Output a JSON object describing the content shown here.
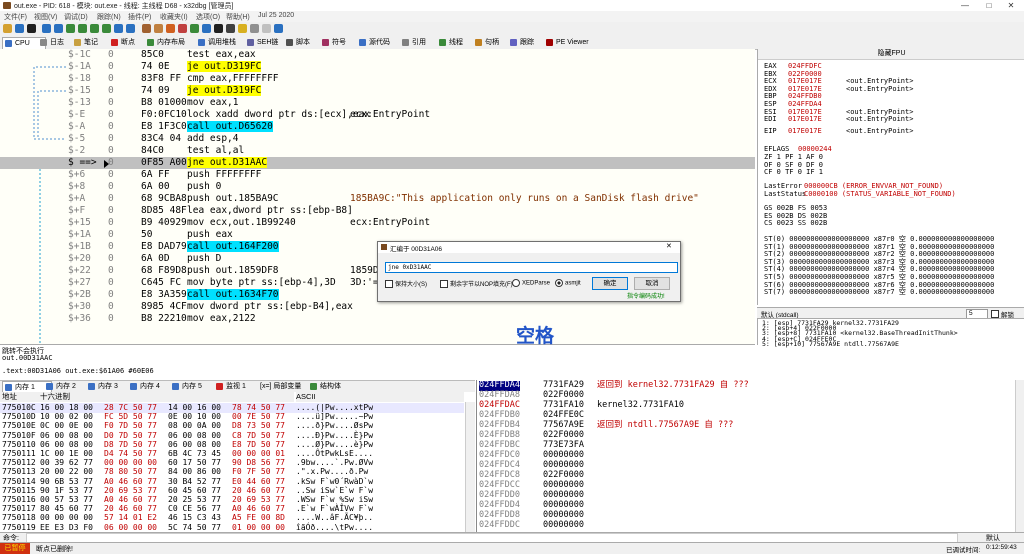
{
  "window": {
    "title": "out.exe - PID: 618 - 模块: out.exe - 线程: 主线程 D68 - x32dbg [管理员]",
    "minimize": "—",
    "maximize": "□",
    "close": "✕"
  },
  "menu": [
    "文件(F)",
    "视图(V)",
    "调试(D)",
    "跟踪(N)",
    "插件(P)",
    "收藏夹(I)",
    "选项(O)",
    "帮助(H)",
    "Jul 25 2020"
  ],
  "tabs": [
    {
      "label": "CPU",
      "color": "#3a6fc4"
    },
    {
      "label": "日志",
      "color": "#888888"
    },
    {
      "label": "笔记",
      "color": "#c8a040"
    },
    {
      "label": "断点",
      "color": "#d02020"
    },
    {
      "label": "内存布局",
      "color": "#3a8a3a"
    },
    {
      "label": "调用堆栈",
      "color": "#3a6fc4"
    },
    {
      "label": "SEH链",
      "color": "#6060a0"
    },
    {
      "label": "脚本",
      "color": "#505050"
    },
    {
      "label": "符号",
      "color": "#a03060"
    },
    {
      "label": "源代码",
      "color": "#3a6fc4"
    },
    {
      "label": "引用",
      "color": "#808080"
    },
    {
      "label": "线程",
      "color": "#3a8a3a"
    },
    {
      "label": "句柄",
      "color": "#c08020"
    },
    {
      "label": "跟踪",
      "color": "#6060c0"
    },
    {
      "label": "PE Viewer",
      "color": "#a00000"
    }
  ],
  "disasm": [
    {
      "label": "$-1C",
      "addr": "0",
      "bytes": "85C0",
      "ins": [
        {
          "t": "test eax,eax"
        }
      ],
      "cmt": ""
    },
    {
      "label": "$-1A",
      "addr": "0",
      "bytes": "74 0E",
      "ins": [
        {
          "t": "je out.D319FC",
          "c": "y"
        }
      ],
      "cmt": ""
    },
    {
      "label": "$-18",
      "addr": "0",
      "bytes": "83F8 FF",
      "ins": [
        {
          "t": "cmp eax,FFFFFFFF"
        }
      ],
      "cmt": ""
    },
    {
      "label": "$-15",
      "addr": "0",
      "bytes": "74 09",
      "ins": [
        {
          "t": "je out.D319FC",
          "c": "y"
        }
      ],
      "cmt": ""
    },
    {
      "label": "$-13",
      "addr": "0",
      "bytes": "B8 01000000",
      "ins": [
        {
          "t": "mov eax,1"
        }
      ],
      "cmt": ""
    },
    {
      "label": "$-E",
      "addr": "0",
      "bytes": "F0:0FC10",
      "ins": [
        {
          "t": "lock xadd dword ptr ds:[ecx],eax"
        }
      ],
      "cmt": "ecx:EntryPoint"
    },
    {
      "label": "$-A",
      "addr": "0",
      "bytes": "E8 1F3C0",
      "ins": [
        {
          "t": "call out.D65620",
          "c": "c"
        }
      ],
      "cmt": ""
    },
    {
      "label": "$-5",
      "addr": "0",
      "bytes": "83C4 04",
      "ins": [
        {
          "t": "add esp,4"
        }
      ],
      "cmt": ""
    },
    {
      "label": "$-2",
      "addr": "0",
      "bytes": "84C0",
      "ins": [
        {
          "t": "test al,al"
        }
      ],
      "cmt": ""
    },
    {
      "label": "$ ==>",
      "addr": "0",
      "bytes": "0F85 A000",
      "ins": [
        {
          "t": "jne out.D31AAC",
          "c": "y"
        }
      ],
      "cmt": "",
      "current": true
    },
    {
      "label": "$+6",
      "addr": "0",
      "bytes": "6A FF",
      "ins": [
        {
          "t": "push FFFFFFFF"
        }
      ],
      "cmt": ""
    },
    {
      "label": "$+8",
      "addr": "0",
      "bytes": "6A 00",
      "ins": [
        {
          "t": "push 0"
        }
      ],
      "cmt": ""
    },
    {
      "label": "$+A",
      "addr": "0",
      "bytes": "68 9CBA85",
      "ins": [
        {
          "t": "push out.185BA9C"
        }
      ],
      "cmt": "185BA9C:\"This application only runs on a SanDisk flash drive\""
    },
    {
      "label": "$+F",
      "addr": "0",
      "bytes": "8D85 48FF",
      "ins": [
        {
          "t": "lea eax,dword ptr ss:[ebp-B8]"
        }
      ],
      "cmt": ""
    },
    {
      "label": "$+15",
      "addr": "0",
      "bytes": "B9 40929B",
      "ins": [
        {
          "t": "mov ecx,out.1B99240"
        }
      ],
      "cmt": "ecx:EntryPoint"
    },
    {
      "label": "$+1A",
      "addr": "0",
      "bytes": "50",
      "ins": [
        {
          "t": "push eax"
        }
      ],
      "cmt": ""
    },
    {
      "label": "$+1B",
      "addr": "0",
      "bytes": "E8 DAD79",
      "ins": [
        {
          "t": "call out.164F200",
          "c": "c"
        }
      ],
      "cmt": ""
    },
    {
      "label": "$+20",
      "addr": "0",
      "bytes": "6A 0D",
      "ins": [
        {
          "t": "push D"
        }
      ],
      "cmt": ""
    },
    {
      "label": "$+22",
      "addr": "0",
      "bytes": "68 F89D8",
      "ins": [
        {
          "t": "push out.1859DF8"
        }
      ],
      "cmt": "1859D"
    },
    {
      "label": "$+27",
      "addr": "0",
      "bytes": "C645 FC",
      "ins": [
        {
          "t": "mov byte ptr ss:[ebp-4],3D"
        }
      ],
      "cmt": "3D:'="
    },
    {
      "label": "$+2B",
      "addr": "0",
      "bytes": "E8 3A359",
      "ins": [
        {
          "t": "call out.1634F70",
          "c": "c"
        }
      ],
      "cmt": ""
    },
    {
      "label": "$+30",
      "addr": "0",
      "bytes": "8985 4CFF",
      "ins": [
        {
          "t": "mov dword ptr ss:[ebp-B4],eax"
        }
      ],
      "cmt": ""
    },
    {
      "label": "$+36",
      "addr": "0",
      "bytes": "B8 22210",
      "ins": [
        {
          "t": "mov eax,2122"
        }
      ],
      "cmt": ""
    }
  ],
  "registers": {
    "header": "隐藏FPU",
    "gp": [
      {
        "n": "EAX",
        "v": "024FFDFC",
        "c": ""
      },
      {
        "n": "EBX",
        "v": "022F0000",
        "c": ""
      },
      {
        "n": "ECX",
        "v": "017E017E",
        "c": "<out.EntryPoint>"
      },
      {
        "n": "EDX",
        "v": "017E017E",
        "c": "<out.EntryPoint>"
      },
      {
        "n": "EBP",
        "v": "024FFDB0",
        "c": ""
      },
      {
        "n": "ESP",
        "v": "024FFDA4",
        "c": ""
      },
      {
        "n": "ESI",
        "v": "017E017E",
        "c": "<out.EntryPoint>"
      },
      {
        "n": "EDI",
        "v": "017E017E",
        "c": "<out.EntryPoint>"
      }
    ],
    "eip": {
      "n": "EIP",
      "v": "017E017E",
      "c": "<out.EntryPoint>"
    },
    "eflags": {
      "n": "EFLAGS",
      "v": "00000244"
    },
    "flags": [
      "ZF 1  PF 1  AF 0",
      "OF 0  SF 0  DF 0",
      "CF 0  TF 0  IF 1"
    ],
    "lasterror": {
      "n": "LastError",
      "v": "000000CB (ERROR_ENVVAR_NOT_FOUND)"
    },
    "laststatus": {
      "n": "LastStatus",
      "v": "C0000100 (STATUS_VARIABLE_NOT_FOUND)"
    },
    "seg": [
      "GS 002B  FS 0053",
      "ES 002B  DS 002B",
      "CS 0023  SS 002B"
    ],
    "st": [
      "ST(0) 0000000000000000000 x87r0 空 0.000000000000000000",
      "ST(1) 0000000000000000000 x87r1 空 0.000000000000000000",
      "ST(2) 0000000000000000000 x87r2 空 0.000000000000000000",
      "ST(3) 0000000000000000000 x87r3 空 0.000000000000000000",
      "ST(4) 0000000000000000000 x87r4 空 0.000000000000000000",
      "ST(5) 0000000000000000000 x87r5 空 0.000000000000000000",
      "ST(6) 0000000000000000000 x87r6 空 0.000000000000000000",
      "ST(7) 0000000000000000000 x87r7 空 0.000000000000000000"
    ]
  },
  "callconv": {
    "label": "默认 (stdcall)",
    "count": "5",
    "unlock": "解锁"
  },
  "callstack": [
    "1: [esp] 7731FA29 kernel32.7731FA29",
    "2: [esp+4] 022F0000",
    "3: [esp+8] 7731FA10 <kernel32.BaseThreadInitThunk>",
    "4: [esp+C] 024FFE0C",
    "5: [esp+10] 77567A9E ntdll.77567A9E"
  ],
  "info": {
    "line1": "跳转不会执行",
    "line2": "out.00D31AAC",
    "line3": ".text:00D31A06 out.exe:$61A06 #60E06"
  },
  "bottom_tabs": [
    "内存 1",
    "内存 2",
    "内存 3",
    "内存 4",
    "内存 5",
    "监视 1",
    "[x=] 局部变量",
    "结构体"
  ],
  "dump": {
    "headers": {
      "addr": "地址",
      "hex": "十六进制",
      "ascii": "ASCII"
    },
    "rows": [
      {
        "a": "775010C",
        "h1": "16 00 18 00",
        "h2": "28 7C 50 77",
        "h3": "14 00 16 00",
        "h4": "78 74 50 77",
        "asc": "....(|Pw....xtPw"
      },
      {
        "a": "775010D",
        "h1": "10 00 02 00",
        "h2": "FC 5D 50 77",
        "h3": "0E 00 10 00",
        "h4": "00 7E 50 77",
        "asc": "....ü]Pw.....~Pw"
      },
      {
        "a": "775010E",
        "h1": "0C 00 0E 00",
        "h2": "F0 7D 50 77",
        "h3": "08 00 0A 00",
        "h4": "D8 73 50 77",
        "asc": "....ð}Pw....ØsPw"
      },
      {
        "a": "775010F",
        "h1": "06 00 08 00",
        "h2": "D0 7D 50 77",
        "h3": "06 00 08 00",
        "h4": "C8 7D 50 77",
        "asc": "....Ð}Pw....È}Pw"
      },
      {
        "a": "7750110",
        "h1": "06 00 08 00",
        "h2": "D8 7D 50 77",
        "h3": "06 00 08 00",
        "h4": "E8 7D 50 77",
        "asc": "....Ø}Pw....è}Pw"
      },
      {
        "a": "7750111",
        "h1": "1C 00 1E 00",
        "h2": "D4 74 50 77",
        "h3": "6B 4C 73 45",
        "h4": "00 00 00 01",
        "asc": "....ÔtPwkLsE...."
      },
      {
        "a": "7750112",
        "h1": "00 39 62 77",
        "h2": "00 00 00 00",
        "h3": "60 17 50 77",
        "h4": "90 D8 56 77",
        "asc": ".9bw....`.Pw.ØVw"
      },
      {
        "a": "7750113",
        "h1": "20 00 22 00",
        "h2": "78 80 50 77",
        "h3": "84 00 86 00",
        "h4": "F0 7F 50 77",
        "asc": " .\".x.Pw....ð.Pw"
      },
      {
        "a": "7750114",
        "h1": "90 6B 53 77",
        "h2": "A0 46 60 77",
        "h3": "30 B4 52 77",
        "h4": "E0 44 60 77",
        "asc": ".kSw F`w0´RwàD`w"
      },
      {
        "a": "7750115",
        "h1": "90 1F 53 77",
        "h2": "20 69 53 77",
        "h3": "60 45 60 77",
        "h4": "20 46 60 77",
        "asc": "..Sw iSw`E`w F`w"
      },
      {
        "a": "7750116",
        "h1": "00 57 53 77",
        "h2": "A0 46 60 77",
        "h3": "20 25 53 77",
        "h4": "20 69 53 77",
        "asc": ".WSw F`w %Sw iSw"
      },
      {
        "a": "7750117",
        "h1": "80 45 60 77",
        "h2": "20 46 60 77",
        "h3": "C0 CE 56 77",
        "h4": "A0 46 60 77",
        "asc": ".E`w F`wÀÎVw F`w"
      },
      {
        "a": "7750118",
        "h1": "00 00 00 00",
        "h2": "57 14 01 E2",
        "h3": "46 15 C3 43",
        "h4": "A5 FE 00 8D",
        "asc": "....W..âF.ÃC¥þ.."
      },
      {
        "a": "7750119",
        "h1": "EE E3 D3 F0",
        "h2": "06 00 00 00",
        "h3": "5C 74 50 77",
        "h4": "01 00 00 00",
        "asc": "îãÓð....\\tPw...."
      }
    ]
  },
  "stack": {
    "rows": [
      {
        "a": "024FFDA4",
        "v": "7731FA29",
        "c": "返回到 kernel32.7731FA29 自 ???",
        "sel": true
      },
      {
        "a": "024FFDA8",
        "v": "022F0000",
        "c": ""
      },
      {
        "a": "024FFDAC",
        "v": "7731FA10",
        "c": "kernel32.7731FA10",
        "red_addr": true
      },
      {
        "a": "024FFDB0",
        "v": "024FFE0C",
        "c": ""
      },
      {
        "a": "024FFDB4",
        "v": "77567A9E",
        "c": "返回到 ntdll.77567A9E 自 ???"
      },
      {
        "a": "024FFDB8",
        "v": "022F0000",
        "c": ""
      },
      {
        "a": "024FFDBC",
        "v": "773E73FA",
        "c": ""
      },
      {
        "a": "024FFDC0",
        "v": "00000000",
        "c": ""
      },
      {
        "a": "024FFDC4",
        "v": "00000000",
        "c": ""
      },
      {
        "a": "024FFDC8",
        "v": "022F0000",
        "c": ""
      },
      {
        "a": "024FFDCC",
        "v": "00000000",
        "c": ""
      },
      {
        "a": "024FFDD0",
        "v": "00000000",
        "c": ""
      },
      {
        "a": "024FFDD4",
        "v": "00000000",
        "c": ""
      },
      {
        "a": "024FFDD8",
        "v": "00000000",
        "c": ""
      },
      {
        "a": "024FFDDC",
        "v": "00000000",
        "c": ""
      }
    ]
  },
  "dialog": {
    "title": "汇编于 00D31A06",
    "value": "jne 0xD31AAC",
    "keep_size": "保持大小(S)",
    "fill_nop": "剩余字节以NOP填充(F)",
    "xedparse": "XEDParse",
    "asmjit": "asmjit",
    "ok": "确定",
    "cancel": "取消",
    "status": "指令编码成功!"
  },
  "overlay_text": "空格",
  "cmdbar": {
    "label": "命令:",
    "right": "默认"
  },
  "statusbar": {
    "state": "已暂停",
    "msg": "断点已删除!",
    "time_label": "已调试时间:",
    "time": "0:12:59:43"
  }
}
